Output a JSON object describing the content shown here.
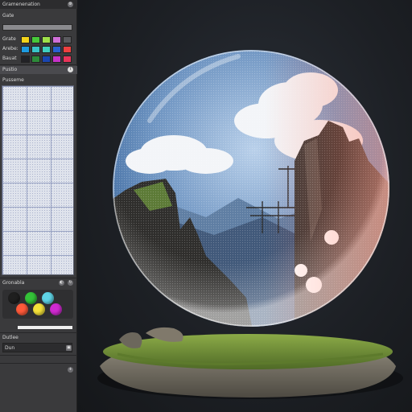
{
  "panel": {
    "title": "Gramenenation",
    "section_color": "Gate",
    "swatch_rows": [
      {
        "label": "Grate",
        "colors": [
          "#f2d31a",
          "#47c83a",
          "#9ee04a",
          "#cf6fd8",
          "#5a5a5e"
        ]
      },
      {
        "label": "Arebe:",
        "colors": [
          "#1d9be0",
          "#38c4c8",
          "#3fd0c0",
          "#2a62d0",
          "#ee4040"
        ]
      },
      {
        "label": "Bauat",
        "colors": [
          "#222226",
          "#2d8a3a",
          "#1a46b0",
          "#c632c8",
          "#e8355a"
        ]
      }
    ],
    "field_label": "Pustio",
    "grid_label": "Pusseme",
    "materials_label": "Gronabla",
    "material_colors": [
      "#1f1f1f",
      "#34c238",
      "#5fd4e6",
      "#ff5a3a",
      "#f5e23a",
      "#d02ad0"
    ],
    "slider_value": 1,
    "row_outline": "Dutlee",
    "row_last": "Dun"
  },
  "scene": {
    "sky_top": "#2e5b93",
    "sky_bottom": "#a8c4e4",
    "rim_color": "#ff5a3a",
    "grass": "#7a9a3a",
    "rock": "#7b7568"
  }
}
